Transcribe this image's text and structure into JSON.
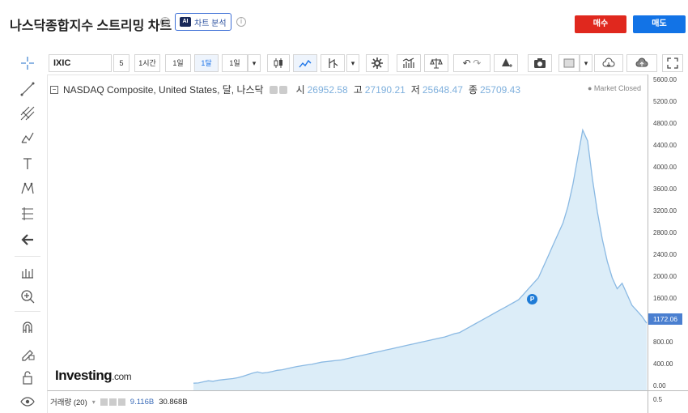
{
  "header": {
    "title": "나스닥종합지수 스트리밍 차트",
    "ai_badge": "AI",
    "ai_button_label": "차트 분석",
    "buy_label": "매수",
    "sell_label": "매도"
  },
  "toolbar": {
    "symbol": "IXIC",
    "buttons": [
      {
        "label": "5",
        "active": false
      },
      {
        "label": "1시간",
        "active": false
      },
      {
        "label": "1일",
        "active": false
      },
      {
        "label": "1달",
        "active": true
      },
      {
        "label": "1일",
        "active": false
      }
    ]
  },
  "legend": {
    "title": "NASDAQ Composite, United States, 달, 나스닥",
    "open_label": "시",
    "open_value": "26952.58",
    "high_label": "고",
    "high_value": "27190.21",
    "low_label": "저",
    "low_value": "25648.47",
    "close_label": "종",
    "close_value": "25709.43",
    "market_status": "● Market Closed"
  },
  "logo": {
    "main": "Investing",
    "suffix": ".com"
  },
  "marker": "P",
  "volume": {
    "label": "거래량 (20)",
    "value1": "9.116B",
    "value2": "30.868B",
    "axis_tick": "0.5"
  },
  "colors": {
    "line": "#8ab9e3",
    "fill": "#dcedf8",
    "accent": "#1273e6",
    "buy": "#e0281e"
  },
  "chart_data": {
    "type": "area",
    "title": "NASDAQ Composite, United States, 달, 나스닥",
    "ylim": [
      -70,
      5700
    ],
    "y_ticks": [
      "5600.00",
      "5200.00",
      "4800.00",
      "4400.00",
      "4000.00",
      "3600.00",
      "3200.00",
      "2800.00",
      "2400.00",
      "2000.00",
      "1600.00",
      "1172.06",
      "800.00",
      "400.00",
      "0.00"
    ],
    "last_price": "1172.06",
    "series": [
      {
        "values": [
          75,
          80,
          100,
          120,
          110,
          130,
          140,
          150,
          160,
          175,
          200,
          230,
          260,
          280,
          260,
          270,
          290,
          310,
          320,
          340,
          360,
          380,
          395,
          410,
          420,
          440,
          460,
          470,
          480,
          490,
          500,
          520,
          540,
          560,
          580,
          600,
          620,
          640,
          660,
          680,
          700,
          720,
          740,
          760,
          780,
          800,
          820,
          840,
          860,
          880,
          900,
          920,
          950,
          980,
          1000,
          1050,
          1100,
          1150,
          1200,
          1250,
          1300,
          1350,
          1400,
          1450,
          1500,
          1550,
          1600,
          1700,
          1800,
          1900,
          2000,
          2200,
          2400,
          2600,
          2800,
          3000,
          3300,
          3700,
          4200,
          4700,
          4500,
          3800,
          3200,
          2700,
          2300,
          2000,
          1800,
          1900,
          1700,
          1500,
          1400,
          1300,
          1172
        ]
      }
    ]
  }
}
